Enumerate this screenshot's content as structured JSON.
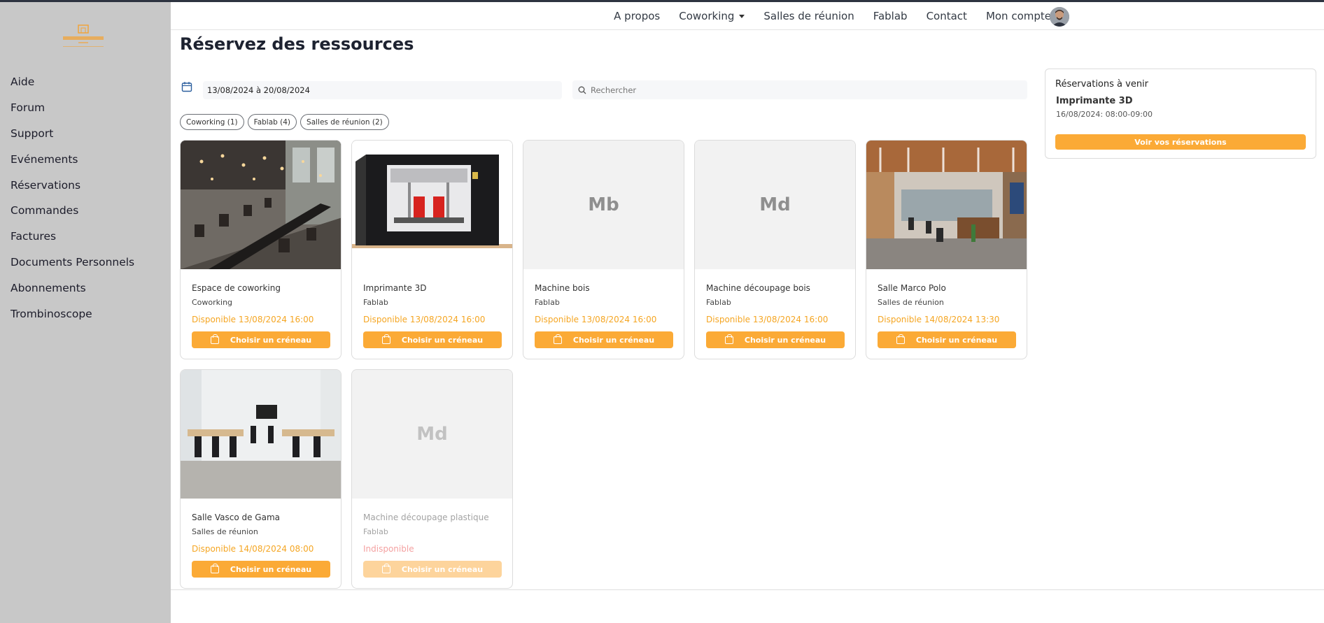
{
  "brand": {
    "accent": "#fbaa36",
    "sidebar_bg": "#c8c8c8"
  },
  "sidebar": {
    "logo_icon": "building-logo",
    "items": [
      {
        "label": "Aide"
      },
      {
        "label": "Forum"
      },
      {
        "label": "Support"
      },
      {
        "label": "Evénements"
      },
      {
        "label": "Réservations"
      },
      {
        "label": "Commandes"
      },
      {
        "label": "Factures"
      },
      {
        "label": "Documents Personnels"
      },
      {
        "label": "Abonnements"
      },
      {
        "label": "Trombinoscope"
      }
    ]
  },
  "topnav": {
    "items": [
      {
        "label": "A propos"
      },
      {
        "label": "Coworking"
      },
      {
        "label": "Salles de réunion"
      },
      {
        "label": "Fablab"
      },
      {
        "label": "Contact"
      },
      {
        "label": "Mon compte"
      }
    ]
  },
  "main": {
    "title": "Réservez des ressources",
    "date_range": "13/08/2024 à 20/08/2024",
    "search_placeholder": "Rechercher",
    "filters": [
      {
        "label": "Coworking (1)"
      },
      {
        "label": "Fablab (4)"
      },
      {
        "label": "Salles de réunion (2)"
      }
    ],
    "button_label": "Choisir un créneau",
    "resources": [
      {
        "name": "Espace de coworking",
        "category": "Coworking",
        "availability": "Disponible 13/08/2024 16:00",
        "image": "coworking-photo"
      },
      {
        "name": "Imprimante 3D",
        "category": "Fablab",
        "availability": "Disponible 13/08/2024 16:00",
        "image": "3d-printer-photo"
      },
      {
        "name": "Machine bois",
        "category": "Fablab",
        "availability": "Disponible 13/08/2024 16:00",
        "initials": "Mb"
      },
      {
        "name": "Machine découpage bois",
        "category": "Fablab",
        "availability": "Disponible 13/08/2024 16:00",
        "initials": "Md"
      },
      {
        "name": "Salle Marco Polo",
        "category": "Salles de réunion",
        "availability": "Disponible 14/08/2024 13:30",
        "image": "meeting-room-photo"
      },
      {
        "name": "Salle Vasco de Gama",
        "category": "Salles de réunion",
        "availability": "Disponible 14/08/2024 08:00",
        "image": "meeting-room-white-photo"
      },
      {
        "name": "Machine découpage plastique",
        "category": "Fablab",
        "availability": "Indisponible",
        "initials": "Md"
      }
    ]
  },
  "upcoming": {
    "heading": "Réservations à venir",
    "item_title": "Imprimante 3D",
    "item_date": "16/08/2024: 08:00-09:00",
    "button_label": "Voir vos réservations"
  }
}
